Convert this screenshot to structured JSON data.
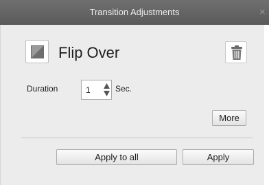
{
  "window": {
    "title": "Transition Adjustments",
    "close_glyph": "×"
  },
  "transition": {
    "name": "Flip Over",
    "thumbnail_icon": "flip-over-thumbnail",
    "delete_icon": "trash-icon"
  },
  "duration": {
    "label": "Duration",
    "value": "1",
    "unit": "Sec."
  },
  "buttons": {
    "more": "More",
    "apply_to_all": "Apply to all",
    "apply": "Apply"
  },
  "colors": {
    "titlebar": "#5f5f5f",
    "panel": "#ececec",
    "title_text": "#eeeeee"
  }
}
